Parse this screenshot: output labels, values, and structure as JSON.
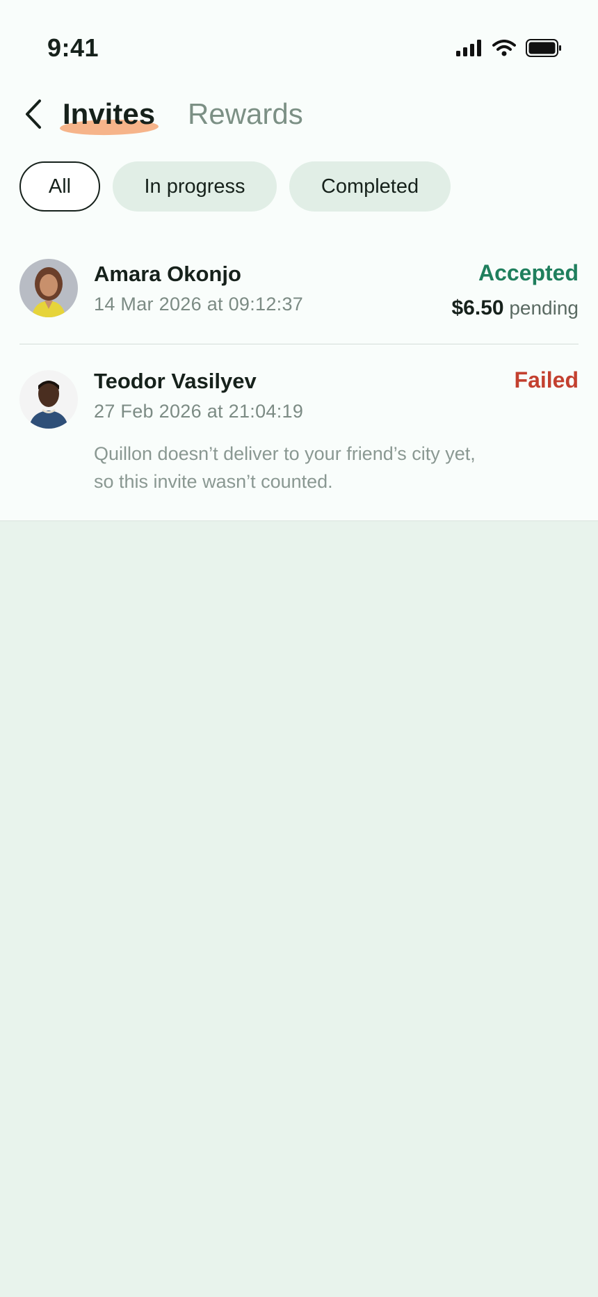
{
  "status_bar": {
    "time": "9:41"
  },
  "header": {
    "tabs": [
      {
        "label": "Invites",
        "active": true
      },
      {
        "label": "Rewards",
        "active": false
      }
    ]
  },
  "filters": [
    {
      "label": "All",
      "selected": true
    },
    {
      "label": "In progress",
      "selected": false
    },
    {
      "label": "Completed",
      "selected": false
    }
  ],
  "invites": [
    {
      "name": "Amara Okonjo",
      "timestamp": "14 Mar 2026 at 09:12:37",
      "status": "Accepted",
      "status_color": "#1f7f5d",
      "reward_amount": "$6.50",
      "reward_state": "pending"
    },
    {
      "name": "Teodor Vasilyev",
      "timestamp": "27 Feb 2026 at 21:04:19",
      "status": "Failed",
      "status_color": "#c3402f",
      "note": "Quillon doesn’t deliver to your friend’s city yet, so this invite wasn’t counted."
    }
  ],
  "colors": {
    "accent_underline": "#f6b48a",
    "accepted": "#1f7f5d",
    "failed": "#c3402f",
    "background_lower": "#e8f3ec"
  }
}
